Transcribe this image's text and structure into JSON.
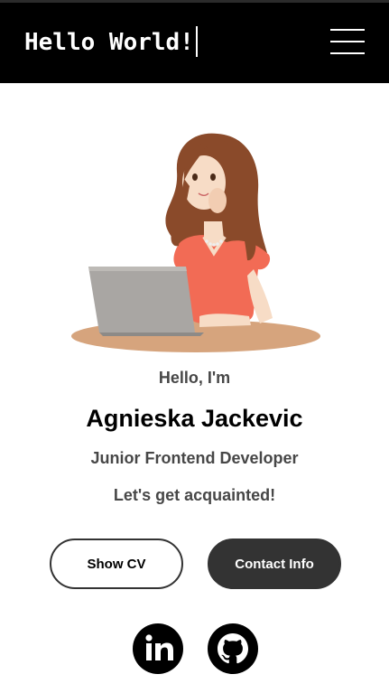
{
  "header": {
    "brand": "Hello World!",
    "menu_icon": "hamburger-menu-icon"
  },
  "hero": {
    "illustration": "woman-at-laptop-illustration",
    "greeting": "Hello, I'm",
    "name": "Agnieska Jackevic",
    "role": "Junior Frontend Developer",
    "tagline": "Let's get acquainted!"
  },
  "actions": {
    "cv_label": "Show CV",
    "contact_label": "Contact Info"
  },
  "social": {
    "icons": [
      "linkedin-icon",
      "github-icon"
    ]
  },
  "colors": {
    "header_bg": "#000000",
    "button_dark": "#333333",
    "text_gray": "#474747"
  }
}
